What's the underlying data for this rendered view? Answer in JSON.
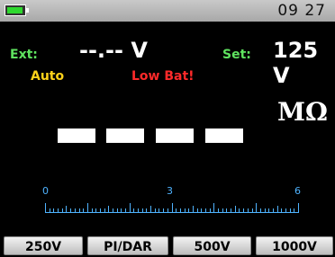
{
  "status_bar": {
    "time": "09 27",
    "battery_icon": "battery-icon",
    "battery_color": "#2fd82f"
  },
  "readings": {
    "ext_label": "Ext:",
    "ext_value": "--.-- V",
    "set_label": "Set:",
    "set_value": "125 V",
    "auto_label": "Auto",
    "low_bat_label": "Low Bat!",
    "main_unit": "MΩ"
  },
  "scale": {
    "labels": [
      "0",
      "3",
      "6"
    ],
    "color": "#4fb3ff"
  },
  "softkeys": [
    {
      "label": "250V"
    },
    {
      "label": "PI/DAR"
    },
    {
      "label": "500V"
    },
    {
      "label": "1000V"
    }
  ]
}
